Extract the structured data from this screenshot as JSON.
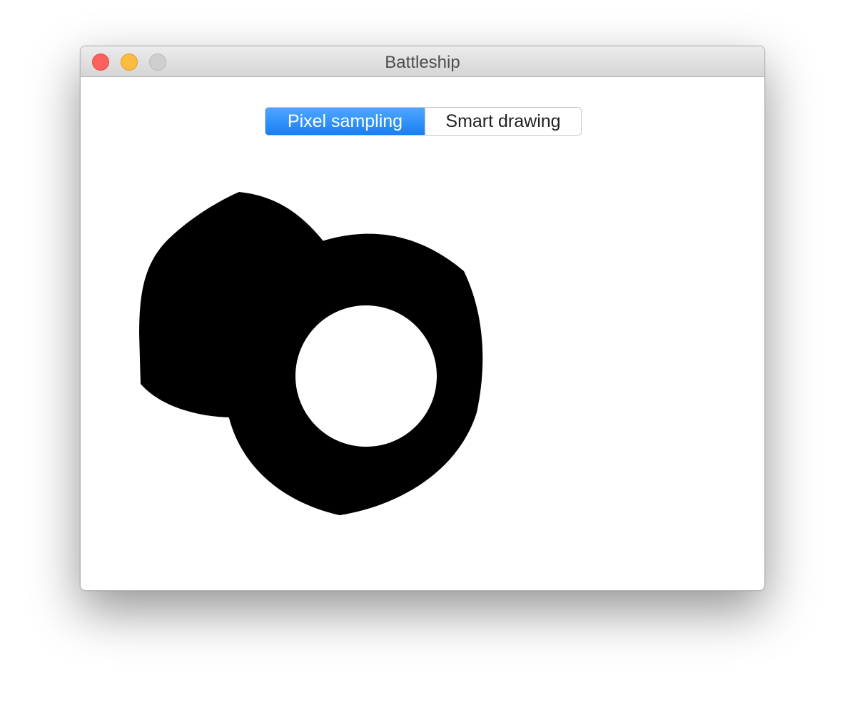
{
  "window": {
    "title": "Battleship"
  },
  "segmented_control": {
    "options": [
      "Pixel sampling",
      "Smart drawing"
    ],
    "selected": "Pixel sampling"
  },
  "colors": {
    "shape": "#000000",
    "background": "#ffffff",
    "selected_segment": "#1a7ff5",
    "close_button": "#fc615d",
    "minimize_button": "#fdbc40",
    "zoom_button": "#cfcfcf"
  }
}
